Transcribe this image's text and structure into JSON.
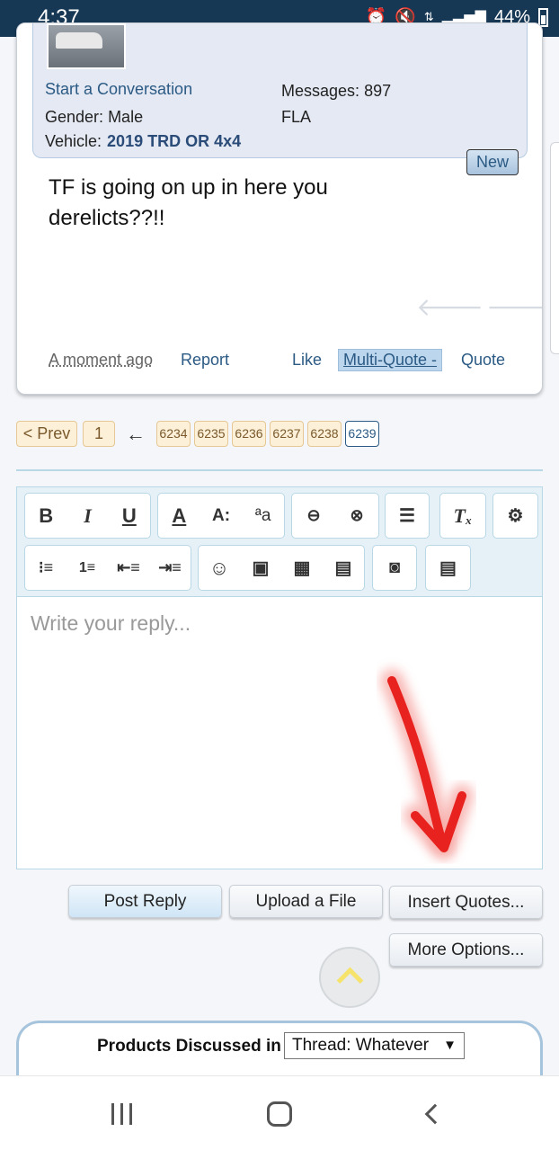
{
  "status_bar": {
    "time": "4:37",
    "battery": "44%",
    "icons": [
      "alarm-icon",
      "mute-icon",
      "data-icon",
      "signal-icon",
      "battery-icon"
    ]
  },
  "post": {
    "user_info": {
      "start_conversation": "Start a Conversation",
      "gender_label": "Gender:",
      "gender_value": "Male",
      "vehicle_label": "Vehicle:",
      "vehicle_value": "2019 TRD OR 4x4",
      "messages_label": "Messages:",
      "messages_value": "897",
      "location": "FLA"
    },
    "new_badge": "New",
    "text": "TF is going on up in here you derelicts??!!",
    "time": "A moment ago",
    "actions": {
      "report": "Report",
      "like": "Like",
      "multiquote": "Multi-Quote -",
      "quote": "Quote"
    }
  },
  "pagination": {
    "prev": "< Prev",
    "first": "1",
    "skip": "←",
    "pages": [
      "6234",
      "6235",
      "6236",
      "6237",
      "6238",
      "6239"
    ],
    "current": "6239"
  },
  "editor": {
    "placeholder": "Write your reply...",
    "toolbar_row1": [
      "bold-icon",
      "italic-icon",
      "underline-icon",
      "font-color-icon",
      "font-size-icon",
      "font-family-icon",
      "link-icon",
      "unlink-icon",
      "align-icon",
      "remove-format-icon",
      "plugin-icon"
    ],
    "toolbar_row2": [
      "bulleted-list-icon",
      "numbered-list-icon",
      "outdent-icon",
      "indent-icon",
      "smiley-icon",
      "image-icon",
      "media-icon",
      "template-icon",
      "camera-icon",
      "save-icon"
    ]
  },
  "buttons": {
    "post_reply": "Post Reply",
    "upload": "Upload a File",
    "insert_quotes": "Insert Quotes...",
    "more_options": "More Options..."
  },
  "products": {
    "label": "Products Discussed in",
    "select_value": "Thread: Whatever"
  },
  "colors": {
    "status_bar": "#173855",
    "link": "#2b5a84",
    "page_badge": "#fdf0d8",
    "annotation_arrow": "#e8221f"
  }
}
